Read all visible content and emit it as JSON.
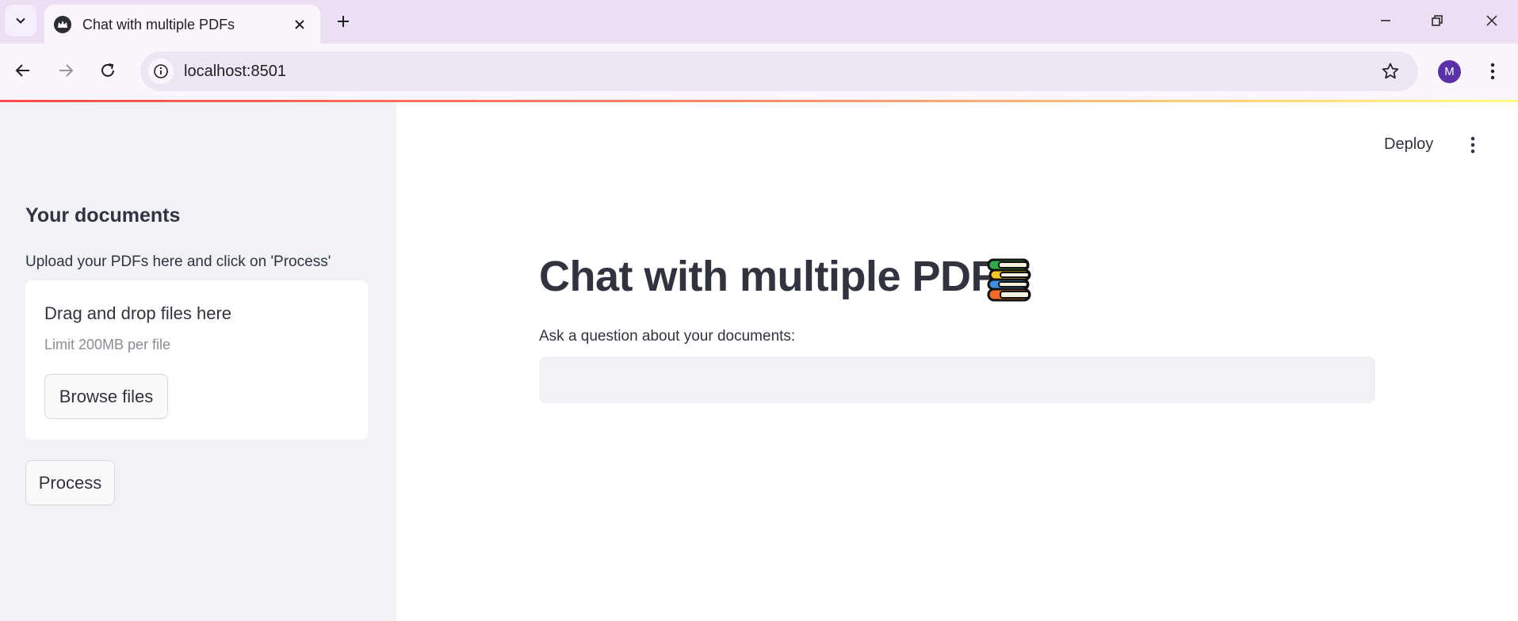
{
  "browser": {
    "tab_title": "Chat with multiple PDFs",
    "url": "localhost:8501",
    "profile_initial": "M"
  },
  "app": {
    "deploy_label": "Deploy",
    "sidebar": {
      "heading": "Your documents",
      "caption": "Upload your PDFs here and click on 'Process'",
      "uploader": {
        "title": "Drag and drop files here",
        "limit": "Limit 200MB per file",
        "browse_label": "Browse files"
      },
      "process_label": "Process"
    },
    "main": {
      "title": "Chat with multiple PDFs",
      "title_icon": "books-icon",
      "question_label": "Ask a question about your documents:",
      "question_value": ""
    }
  },
  "colors": {
    "accent_gradient_start": "#ff4b4b",
    "accent_gradient_end": "#fffd80",
    "sidebar_bg": "#f0f2f6",
    "text": "#31333f",
    "profile": "#5b31a8"
  }
}
